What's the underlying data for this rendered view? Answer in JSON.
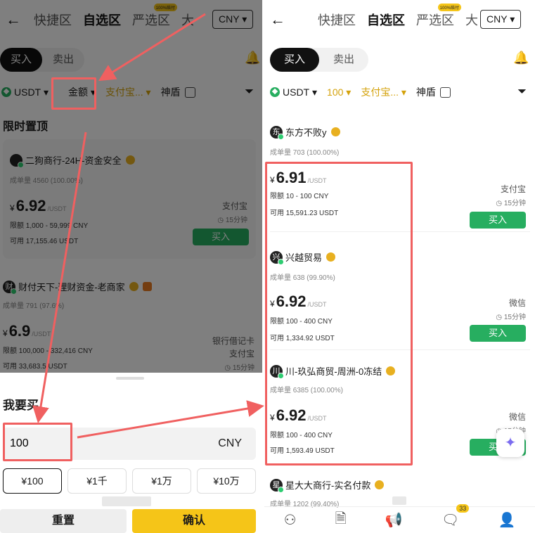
{
  "left": {
    "nav": {
      "back": "←",
      "tabs": [
        "快捷区",
        "自选区",
        "严选区",
        "大"
      ],
      "active_index": 1,
      "badge": "100%赔付",
      "currency": "CNY"
    },
    "seg": {
      "buy": "买入",
      "sell": "卖出"
    },
    "filter": {
      "coin": "USDT",
      "amount": "金额",
      "pay": "支付宝...",
      "shield": "神盾"
    },
    "section_title": "限时置顶",
    "cards": [
      {
        "avatar": "",
        "name": "二狗商行-24H-资金安全",
        "meta": "成单量 4560 (100.00%)",
        "yen": "¥",
        "price": "6.92",
        "unit": "/USDT",
        "limit": "限额 1,000 - 59,999 CNY",
        "avail": "可用 17,155.46 USDT",
        "pays": [
          "支付宝"
        ],
        "time": "15分钟",
        "buy": "买入"
      },
      {
        "avatar": "财",
        "name": "财付天下-理财资金-老商家",
        "meta": "成单量 791 (97.6%)",
        "yen": "¥",
        "price": "6.9",
        "unit": "/USDT",
        "limit": "限额 100,000 - 332,416 CNY",
        "avail": "可用 33,683.5 USDT",
        "pays": [
          "银行借记卡",
          "支付宝"
        ],
        "time": "15分钟"
      }
    ],
    "sheet": {
      "title": "我要买",
      "amount": "100",
      "currency": "CNY",
      "quick": [
        "¥100",
        "¥1千",
        "¥1万",
        "¥10万"
      ],
      "reset": "重置",
      "confirm": "确认"
    }
  },
  "right": {
    "nav": {
      "back": "←",
      "tabs": [
        "快捷区",
        "自选区",
        "严选区",
        "大"
      ],
      "active_index": 1,
      "badge": "100%赔付",
      "currency": "CNY"
    },
    "seg": {
      "buy": "买入",
      "sell": "卖出"
    },
    "filter": {
      "coin": "USDT",
      "amount": "100",
      "pay": "支付宝...",
      "shield": "神盾"
    },
    "cards": [
      {
        "avatar": "东",
        "name": "东方不败y",
        "meta": "成单量 703 (100.00%)",
        "yen": "¥",
        "price": "6.91",
        "unit": "/USDT",
        "limit": "限额 10 - 100 CNY",
        "avail": "可用 15,591.23 USDT",
        "pay": "支付宝",
        "time": "15分钟",
        "buy": "买入"
      },
      {
        "avatar": "兴",
        "name": "兴越贸易",
        "meta": "成单量 638 (99.90%)",
        "yen": "¥",
        "price": "6.92",
        "unit": "/USDT",
        "limit": "限额 100 - 400 CNY",
        "avail": "可用 1,334.92 USDT",
        "pay": "微信",
        "time": "15分钟",
        "buy": "买入"
      },
      {
        "avatar": "川",
        "name": "川-玖弘商贸-周洲-0冻结",
        "meta": "成单量 6385 (100.00%)",
        "yen": "¥",
        "price": "6.92",
        "unit": "/USDT",
        "limit": "限额 100 - 400 CNY",
        "avail": "可用 1,593.49 USDT",
        "pay": "微信",
        "time": "15分钟",
        "buy": "买入"
      },
      {
        "avatar": "星",
        "name": "星大大商行-实名付款",
        "meta": "成单量 1202 (99.40%)"
      }
    ],
    "bottom_badge": "33"
  },
  "colors": {
    "accent": "#f5c518",
    "buy": "#27ae60",
    "highlight": "#f06060"
  }
}
